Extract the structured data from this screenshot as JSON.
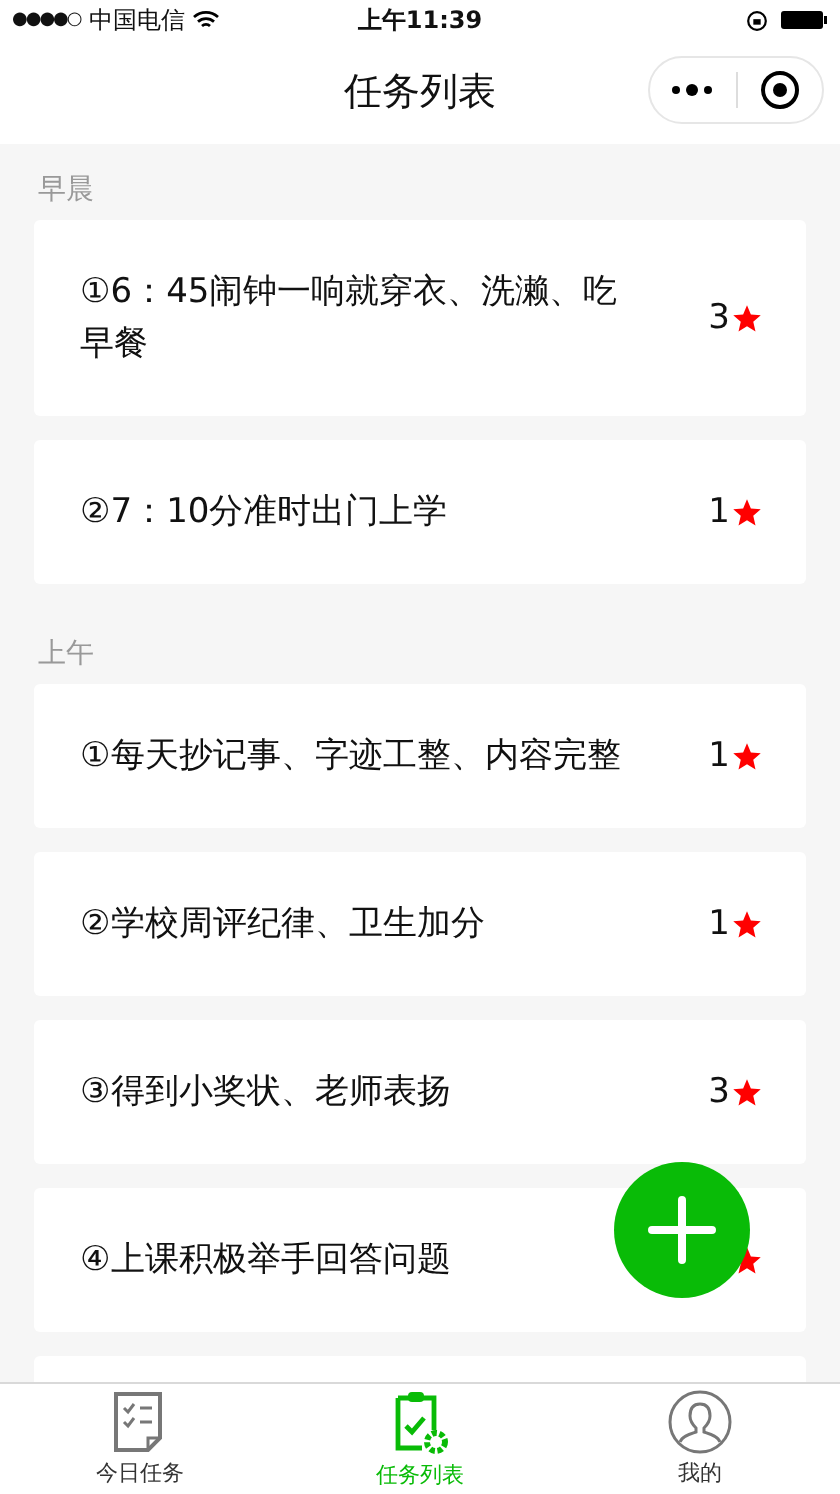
{
  "status_bar": {
    "signal": "●●●●○",
    "carrier": "中国电信",
    "time": "上午11:39"
  },
  "nav": {
    "title": "任务列表"
  },
  "sections": [
    {
      "title": "早晨",
      "tasks": [
        {
          "kind": "task",
          "index": "①",
          "text": "6：45闹钟一响就穿衣、洗濑、吃早餐",
          "count": "3"
        },
        {
          "kind": "task",
          "index": "②",
          "text": "7：10分准时出门上学",
          "count": "1"
        }
      ]
    },
    {
      "title": "上午",
      "tasks": [
        {
          "kind": "task",
          "index": "①",
          "text": "每天抄记事、字迹工整、内容完整",
          "count": "1"
        },
        {
          "kind": "task",
          "index": "②",
          "text": "学校周评纪律、卫生加分",
          "count": "1"
        },
        {
          "kind": "task",
          "index": "③",
          "text": "得到小奖状、老师表扬",
          "count": "3"
        },
        {
          "kind": "task",
          "index": "④",
          "text": "上课积极举手回答问题"
        },
        {
          "kind": "empty"
        }
      ]
    }
  ],
  "tabs": [
    {
      "label": "今日任务",
      "kind": "checklist",
      "selected": false
    },
    {
      "label": "任务列表",
      "kind": "clipboard",
      "selected": true
    },
    {
      "label": "我的",
      "kind": "person",
      "selected": false
    }
  ]
}
